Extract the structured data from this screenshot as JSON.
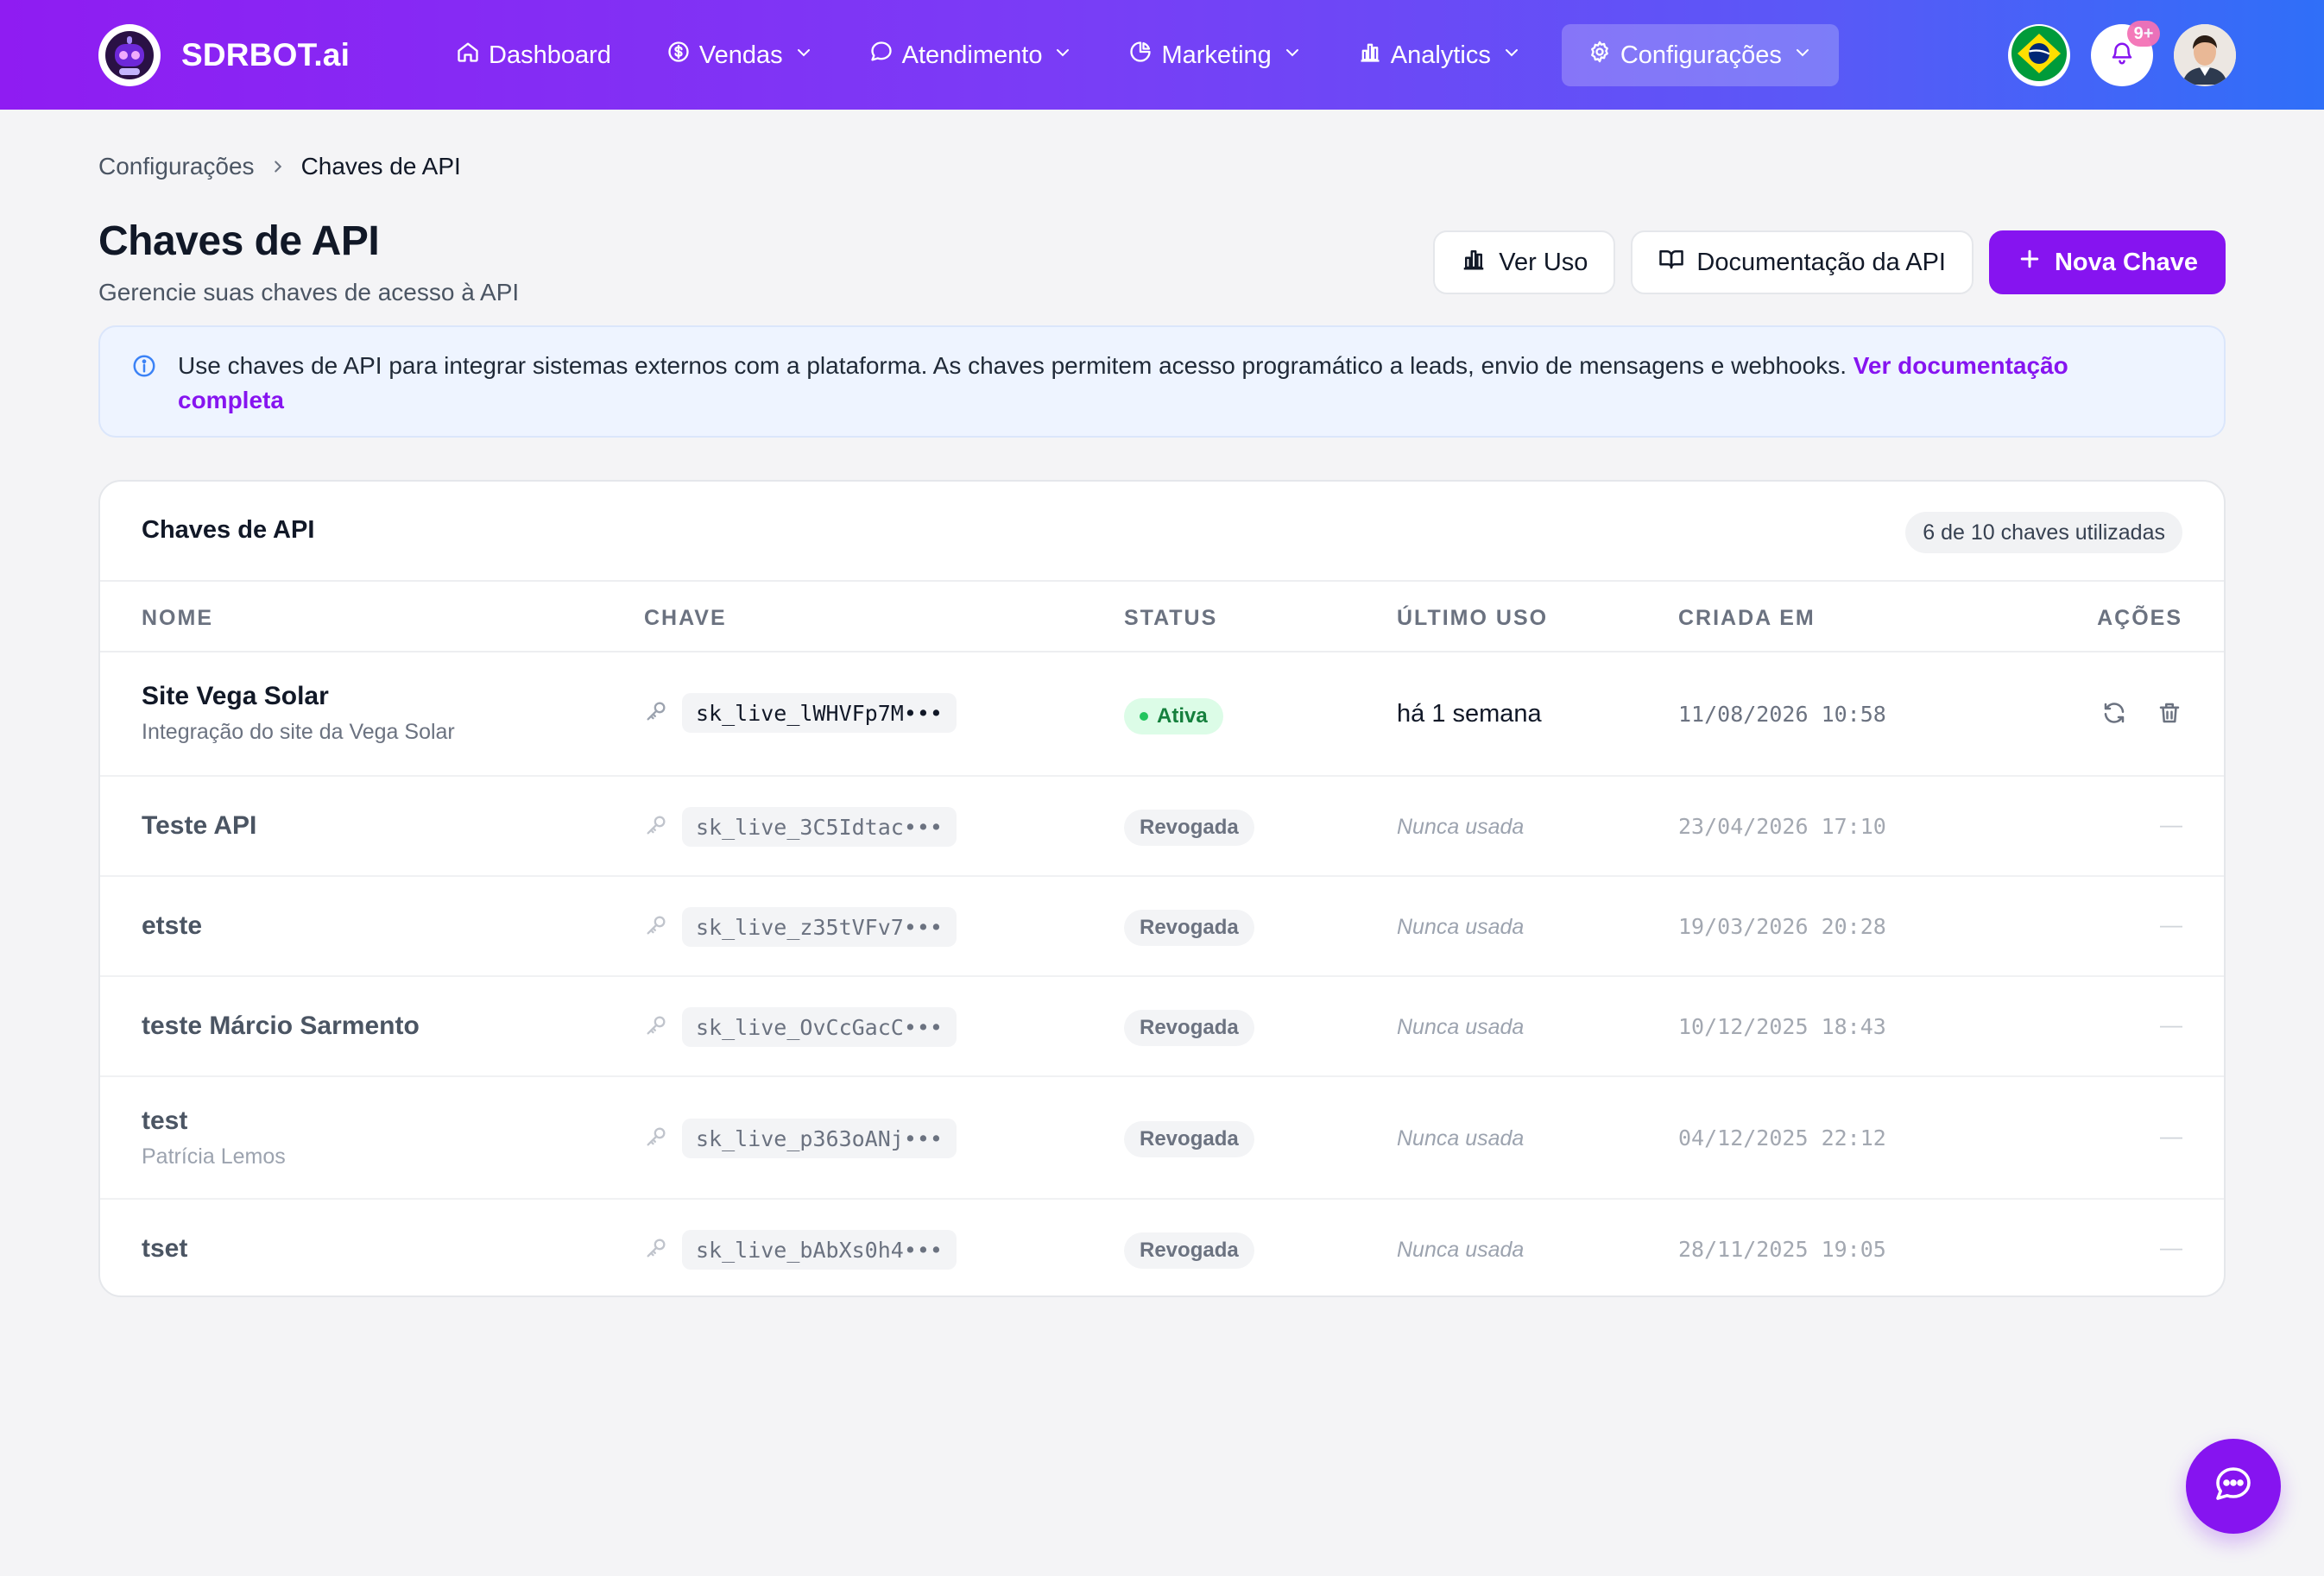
{
  "brand": {
    "name": "SDRBOT.ai"
  },
  "nav": {
    "items": [
      {
        "label": "Dashboard",
        "icon": "home-icon",
        "has_menu": false,
        "active": false
      },
      {
        "label": "Vendas",
        "icon": "dollar-circle-icon",
        "has_menu": true,
        "active": false
      },
      {
        "label": "Atendimento",
        "icon": "chat-bubble-icon",
        "has_menu": true,
        "active": false
      },
      {
        "label": "Marketing",
        "icon": "pie-chart-icon",
        "has_menu": true,
        "active": false
      },
      {
        "label": "Analytics",
        "icon": "bar-chart-icon",
        "has_menu": true,
        "active": false
      },
      {
        "label": "Configurações",
        "icon": "gear-icon",
        "has_menu": true,
        "active": true
      }
    ],
    "notifications_badge": "9+"
  },
  "breadcrumb": {
    "parent": "Configurações",
    "current": "Chaves de API"
  },
  "page": {
    "title": "Chaves de API",
    "subtitle": "Gerencie suas chaves de acesso à API"
  },
  "actions": {
    "usage": "Ver Uso",
    "docs": "Documentação da API",
    "new_key": "Nova Chave"
  },
  "info": {
    "text": "Use chaves de API para integrar sistemas externos com a plataforma. As chaves permitem acesso programático a leads, envio de mensagens e webhooks. ",
    "link": "Ver documentação completa"
  },
  "table": {
    "title": "Chaves de API",
    "usage": "6 de 10 chaves utilizadas",
    "headers": {
      "name": "NOME",
      "key": "CHAVE",
      "status": "STATUS",
      "last_use": "ÚLTIMO USO",
      "created": "CRIADA EM",
      "actions": "AÇÕES"
    },
    "rows": [
      {
        "name": "Site Vega Solar",
        "desc": "Integração do site da Vega Solar",
        "key": "sk_live_lWHVFp7M•••",
        "status": "Ativa",
        "last_use": "há 1 semana",
        "created": "11/08/2026 10:58",
        "actions": ""
      },
      {
        "name": "Teste API",
        "desc": "",
        "key": "sk_live_3C5Idtac•••",
        "status": "Revogada",
        "last_use": "Nunca usada",
        "created": "23/04/2026 17:10",
        "actions": "—"
      },
      {
        "name": "etste",
        "desc": "",
        "key": "sk_live_z35tVFv7•••",
        "status": "Revogada",
        "last_use": "Nunca usada",
        "created": "19/03/2026 20:28",
        "actions": "—"
      },
      {
        "name": "teste Márcio Sarmento",
        "desc": "",
        "key": "sk_live_OvCcGacC•••",
        "status": "Revogada",
        "last_use": "Nunca usada",
        "created": "10/12/2025 18:43",
        "actions": "—"
      },
      {
        "name": "test",
        "desc": "Patrícia Lemos",
        "key": "sk_live_p363oANj•••",
        "status": "Revogada",
        "last_use": "Nunca usada",
        "created": "04/12/2025 22:12",
        "actions": "—"
      },
      {
        "name": "tset",
        "desc": "",
        "key": "sk_live_bAbXs0h4•••",
        "status": "Revogada",
        "last_use": "Nunca usada",
        "created": "28/11/2025 19:05",
        "actions": "—"
      }
    ]
  },
  "colors": {
    "brand_purple": "#8614f0",
    "active_green": "#15803d",
    "link": "#8614f0"
  }
}
